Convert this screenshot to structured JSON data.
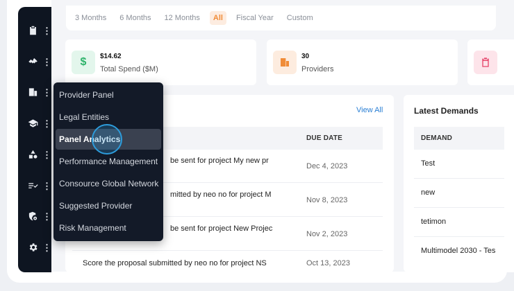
{
  "periods": [
    {
      "label": "3 Months",
      "active": false
    },
    {
      "label": "6 Months",
      "active": false
    },
    {
      "label": "12 Months",
      "active": false
    },
    {
      "label": "All",
      "active": true
    },
    {
      "label": "Fiscal Year",
      "active": false
    },
    {
      "label": "Custom",
      "active": false
    }
  ],
  "stats": [
    {
      "value": "$14.62",
      "label": "Total Spend ($M)",
      "icon": "dollar-icon",
      "color": "#2fb36b",
      "bg": "#e3f6ec"
    },
    {
      "value": "30",
      "label": "Providers",
      "icon": "building-icon",
      "color": "#f08c38",
      "bg": "#fdecdf"
    },
    {
      "value": "",
      "label": "",
      "icon": "clipboard-icon",
      "color": "#e6456a",
      "bg": "#fde4ea"
    }
  ],
  "tasks": {
    "view_all": "View All",
    "due_date_header": "DUE DATE",
    "rows": [
      {
        "text": "be sent for project My new pr",
        "date": "Dec 4, 2023"
      },
      {
        "text": "mitted by neo no for project M",
        "date": "Nov 8, 2023"
      },
      {
        "text": "be sent for project New Projec",
        "date": "Nov 2, 2023"
      },
      {
        "text": "Score the proposal submitted by neo no for project NS",
        "date": "Oct 13, 2023"
      }
    ]
  },
  "demands": {
    "title": "Latest Demands",
    "header": "DEMAND",
    "rows": [
      "Test",
      "new",
      "tetimon",
      "Multimodel 2030 - Tes"
    ]
  },
  "dropdown": {
    "items": [
      "Provider Panel",
      "Legal Entities",
      "Panel Analytics",
      "Performance Management",
      "Consource Global Network",
      "Suggested Provider",
      "Risk Management"
    ],
    "selected_index": 2
  },
  "sidebar": {
    "icons": [
      "clipboard-icon",
      "handshake-icon",
      "building-icon",
      "graduation-cap-icon",
      "shapes-icon",
      "checklist-icon",
      "shield-gear-icon",
      "gear-icon"
    ]
  },
  "colors": {
    "accent": "#f08c38",
    "link": "#2a7fd4",
    "sidebar": "#0e1521"
  }
}
